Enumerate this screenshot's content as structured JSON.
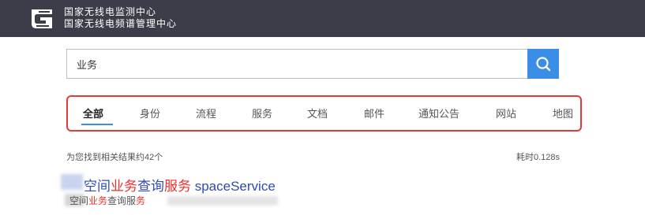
{
  "header": {
    "logo_icon": "srrc-logo-icon",
    "org_line1": "国家无线电监测中心",
    "org_line2": "国家无线电频谱管理中心",
    "background": "#3b3e48"
  },
  "search": {
    "value": "业务",
    "button_icon": "search-icon",
    "button_color": "#3a8ee6"
  },
  "tabs": {
    "items": [
      {
        "label": "全部",
        "active": true
      },
      {
        "label": "身份",
        "active": false
      },
      {
        "label": "流程",
        "active": false
      },
      {
        "label": "服务",
        "active": false
      },
      {
        "label": "文档",
        "active": false
      },
      {
        "label": "邮件",
        "active": false
      },
      {
        "label": "通知公告",
        "active": false
      },
      {
        "label": "网站",
        "active": false
      },
      {
        "label": "地图",
        "active": false
      }
    ],
    "highlight_border_color": "#e23b3b"
  },
  "results": {
    "count_text": "为您找到相关结果约42个",
    "elapsed_text": "耗时0.128s",
    "items": [
      {
        "title_pre": "空间",
        "title_hl1": "业务",
        "title_mid": "查询",
        "title_hl2": "服务",
        "title_post": " spaceService",
        "desc_pre": "空间",
        "desc_hl1": "业务",
        "desc_mid": "查询服",
        "desc_hl2": "务"
      }
    ]
  }
}
